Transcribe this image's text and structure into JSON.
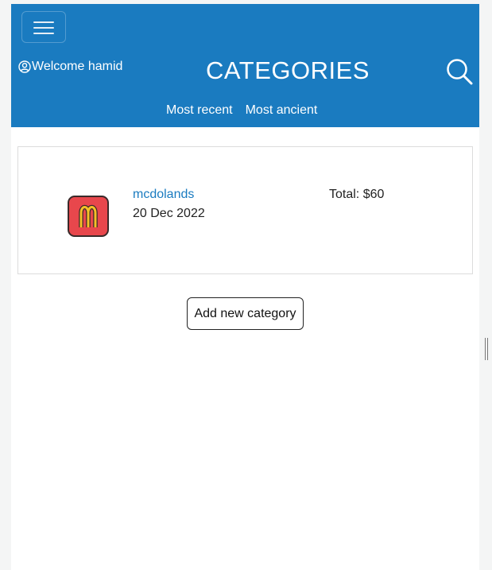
{
  "header": {
    "welcome": "Welcome hamid",
    "title": "CATEGORIES",
    "sort_options": [
      "Most recent",
      "Most ancient"
    ]
  },
  "categories": [
    {
      "name": "mcdolands",
      "date": "20 Dec 2022",
      "total": "Total: $60",
      "icon": "mcdonalds-logo-icon"
    }
  ],
  "actions": {
    "add_category_label": "Add new category"
  },
  "colors": {
    "brand": "#1a7bc0",
    "logo_bg": "#e8474c",
    "logo_arches": "#f5c027"
  }
}
